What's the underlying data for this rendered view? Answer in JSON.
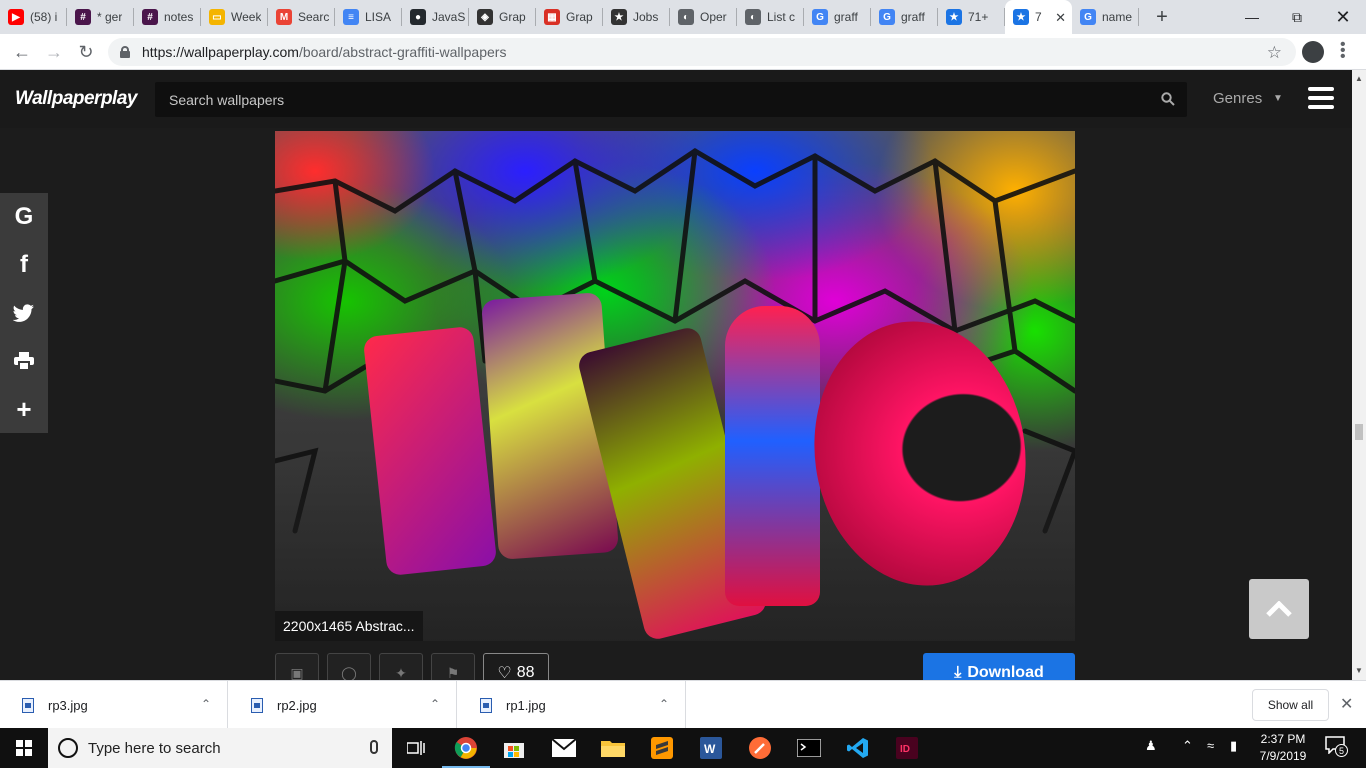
{
  "browser": {
    "tabs": [
      {
        "label": "(58) i",
        "icon": "youtube-icon",
        "color": "#ff0000"
      },
      {
        "label": "* ger",
        "icon": "slack-icon",
        "color": "#4a154b"
      },
      {
        "label": "notes",
        "icon": "slack-icon",
        "color": "#4a154b"
      },
      {
        "label": "Week",
        "icon": "google-slides-icon",
        "color": "#f4b400"
      },
      {
        "label": "Searc",
        "icon": "gmail-icon",
        "color": "#ea4335"
      },
      {
        "label": "LISA",
        "icon": "google-docs-icon",
        "color": "#4285f4"
      },
      {
        "label": "JavaS",
        "icon": "github-icon",
        "color": "#24292e"
      },
      {
        "label": "Grap",
        "icon": "graphql-icon",
        "color": "#333333"
      },
      {
        "label": "Grap",
        "icon": "graph-icon",
        "color": "#d93025"
      },
      {
        "label": "Jobs",
        "icon": "star-outline-icon",
        "color": "#333333"
      },
      {
        "label": "Oper",
        "icon": "globe-icon",
        "color": "#5f6368"
      },
      {
        "label": "List c",
        "icon": "globe-icon",
        "color": "#5f6368"
      },
      {
        "label": "graff",
        "icon": "google-icon",
        "color": "#4285f4"
      },
      {
        "label": "graff",
        "icon": "google-icon",
        "color": "#4285f4"
      },
      {
        "label": "71+",
        "icon": "star-icon",
        "color": "#1b74e4"
      },
      {
        "label": "7",
        "icon": "star-icon",
        "color": "#1b74e4",
        "active": true
      },
      {
        "label": "name",
        "icon": "google-icon",
        "color": "#4285f4"
      }
    ],
    "url_host": "https://wallpaperplay.com",
    "url_path": "/board/abstract-graffiti-wallpapers"
  },
  "site": {
    "logo": "Wallpaperplay",
    "search_placeholder": "Search wallpapers",
    "genres_label": "Genres",
    "caption": "2200x1465 Abstrac...",
    "like_count": "88",
    "download_label": "Download",
    "share_items": [
      "G",
      "f",
      "t",
      "p",
      "+"
    ]
  },
  "downloads": {
    "items": [
      "rp3.jpg",
      "rp2.jpg",
      "rp1.jpg"
    ],
    "show_all": "Show all"
  },
  "taskbar": {
    "search_placeholder": "Type here to search",
    "time": "2:37 PM",
    "date": "7/9/2019",
    "notification_count": "5"
  },
  "colors": {
    "accent": "#1b74e4",
    "header_bg": "#1a1a1a",
    "page_bg": "#1c1c1c"
  }
}
